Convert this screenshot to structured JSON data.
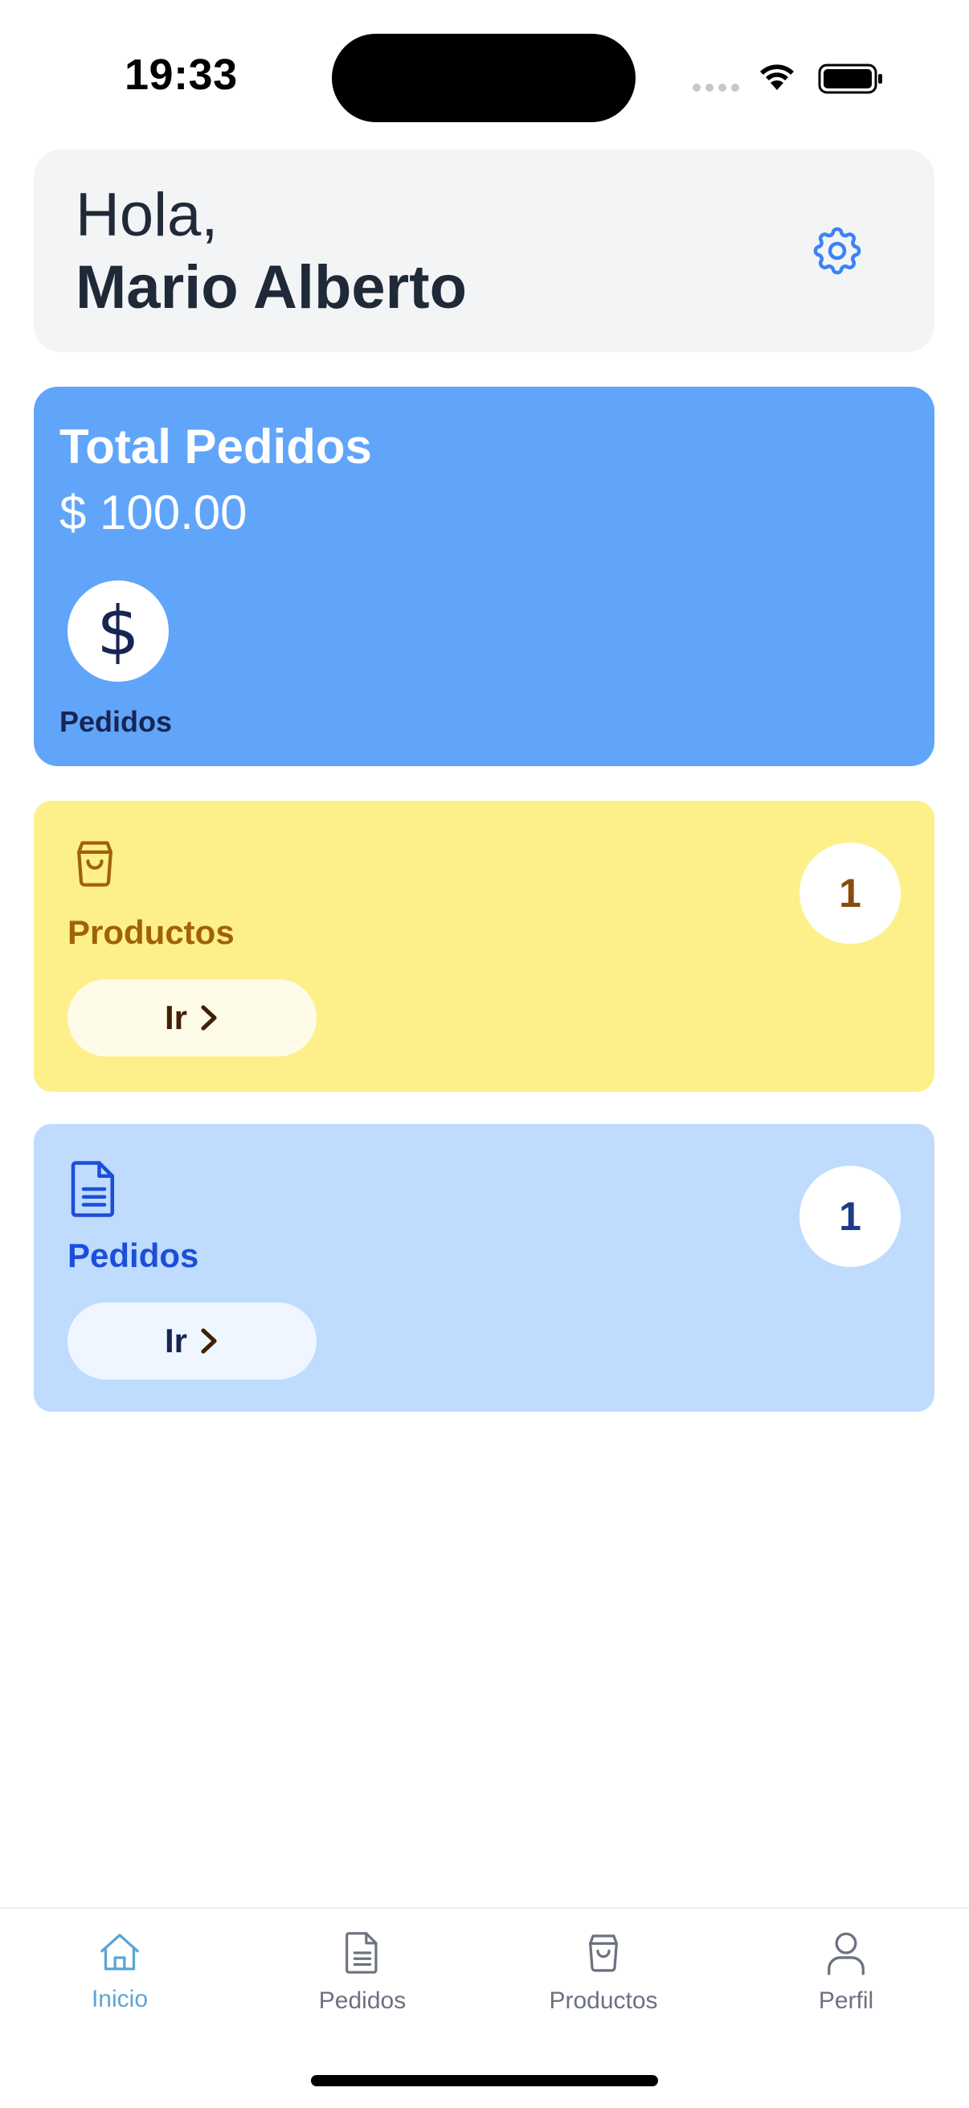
{
  "status_bar": {
    "time": "19:33",
    "icons": [
      "cellular-signal-icon",
      "wifi-icon",
      "battery-icon"
    ]
  },
  "greeting": {
    "hello": "Hola,",
    "name": "Mario Alberto",
    "settings_icon": "gear-icon"
  },
  "summary": {
    "title": "Total Pedidos",
    "amount": "$ 100.00",
    "icon": "dollar-icon",
    "icon_glyph": "$",
    "label": "Pedidos"
  },
  "modules": {
    "products": {
      "icon": "shopping-bag-icon",
      "title": "Productos",
      "count": "1",
      "button_label": "Ir",
      "colors": {
        "background": "#fdf08a",
        "accent": "#a16207"
      }
    },
    "orders": {
      "icon": "document-icon",
      "title": "Pedidos",
      "count": "1",
      "button_label": "Ir",
      "colors": {
        "background": "#bfdbfe",
        "accent": "#1d4ed8"
      }
    }
  },
  "tab_bar": {
    "active": "Inicio",
    "tabs": [
      {
        "label": "Inicio",
        "icon": "home-icon"
      },
      {
        "label": "Pedidos",
        "icon": "document-icon"
      },
      {
        "label": "Productos",
        "icon": "shopping-bag-icon"
      },
      {
        "label": "Perfil",
        "icon": "user-icon"
      }
    ]
  },
  "colors": {
    "primary_card": "#60a5fa",
    "active_tab": "#5ba4d6",
    "inactive_tab": "#6b7280"
  }
}
